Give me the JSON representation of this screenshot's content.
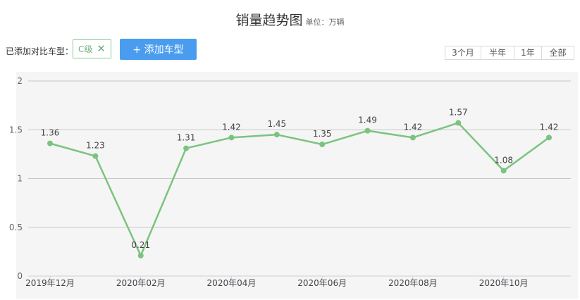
{
  "header": {
    "title": "销量趋势图",
    "unit": "单位：万辆"
  },
  "controls": {
    "added_label": "已添加对比车型：",
    "chip_label": "C级",
    "chip_close_icon": "close-icon",
    "add_button_label": "+ 添加车型",
    "ranges": [
      {
        "label": "3个月",
        "active": false
      },
      {
        "label": "半年",
        "active": false
      },
      {
        "label": "1年",
        "active": true
      },
      {
        "label": "全部",
        "active": false
      }
    ]
  },
  "colors": {
    "line": "#7ac47f",
    "accent": "#4a9cee",
    "chip": "#6cb27e",
    "active_range": "#9e9e9e"
  },
  "chart_data": {
    "type": "line",
    "x": [
      "2019年12月",
      "2020年01月",
      "2020年02月",
      "2020年03月",
      "2020年04月",
      "2020年05月",
      "2020年06月",
      "2020年07月",
      "2020年08月",
      "2020年09月",
      "2020年10月",
      "2020年11月"
    ],
    "x_tick_labels": [
      "2019年12月",
      "2020年02月",
      "2020年04月",
      "2020年06月",
      "2020年08月",
      "2020年10月"
    ],
    "series": [
      {
        "values": [
          1.36,
          1.23,
          0.21,
          1.31,
          1.42,
          1.45,
          1.35,
          1.49,
          1.42,
          1.57,
          1.08,
          1.42
        ]
      }
    ],
    "data_labels": [
      "1.36",
      "1.23",
      "0.21",
      "1.31",
      "1.42",
      "1.45",
      "1.35",
      "1.49",
      "1.42",
      "1.57",
      "1.08",
      "1.42"
    ],
    "y_ticks": [
      "0",
      "0.5",
      "1",
      "1.5",
      "2"
    ],
    "ylim": [
      0,
      2
    ],
    "grid": true,
    "legend": "none"
  }
}
